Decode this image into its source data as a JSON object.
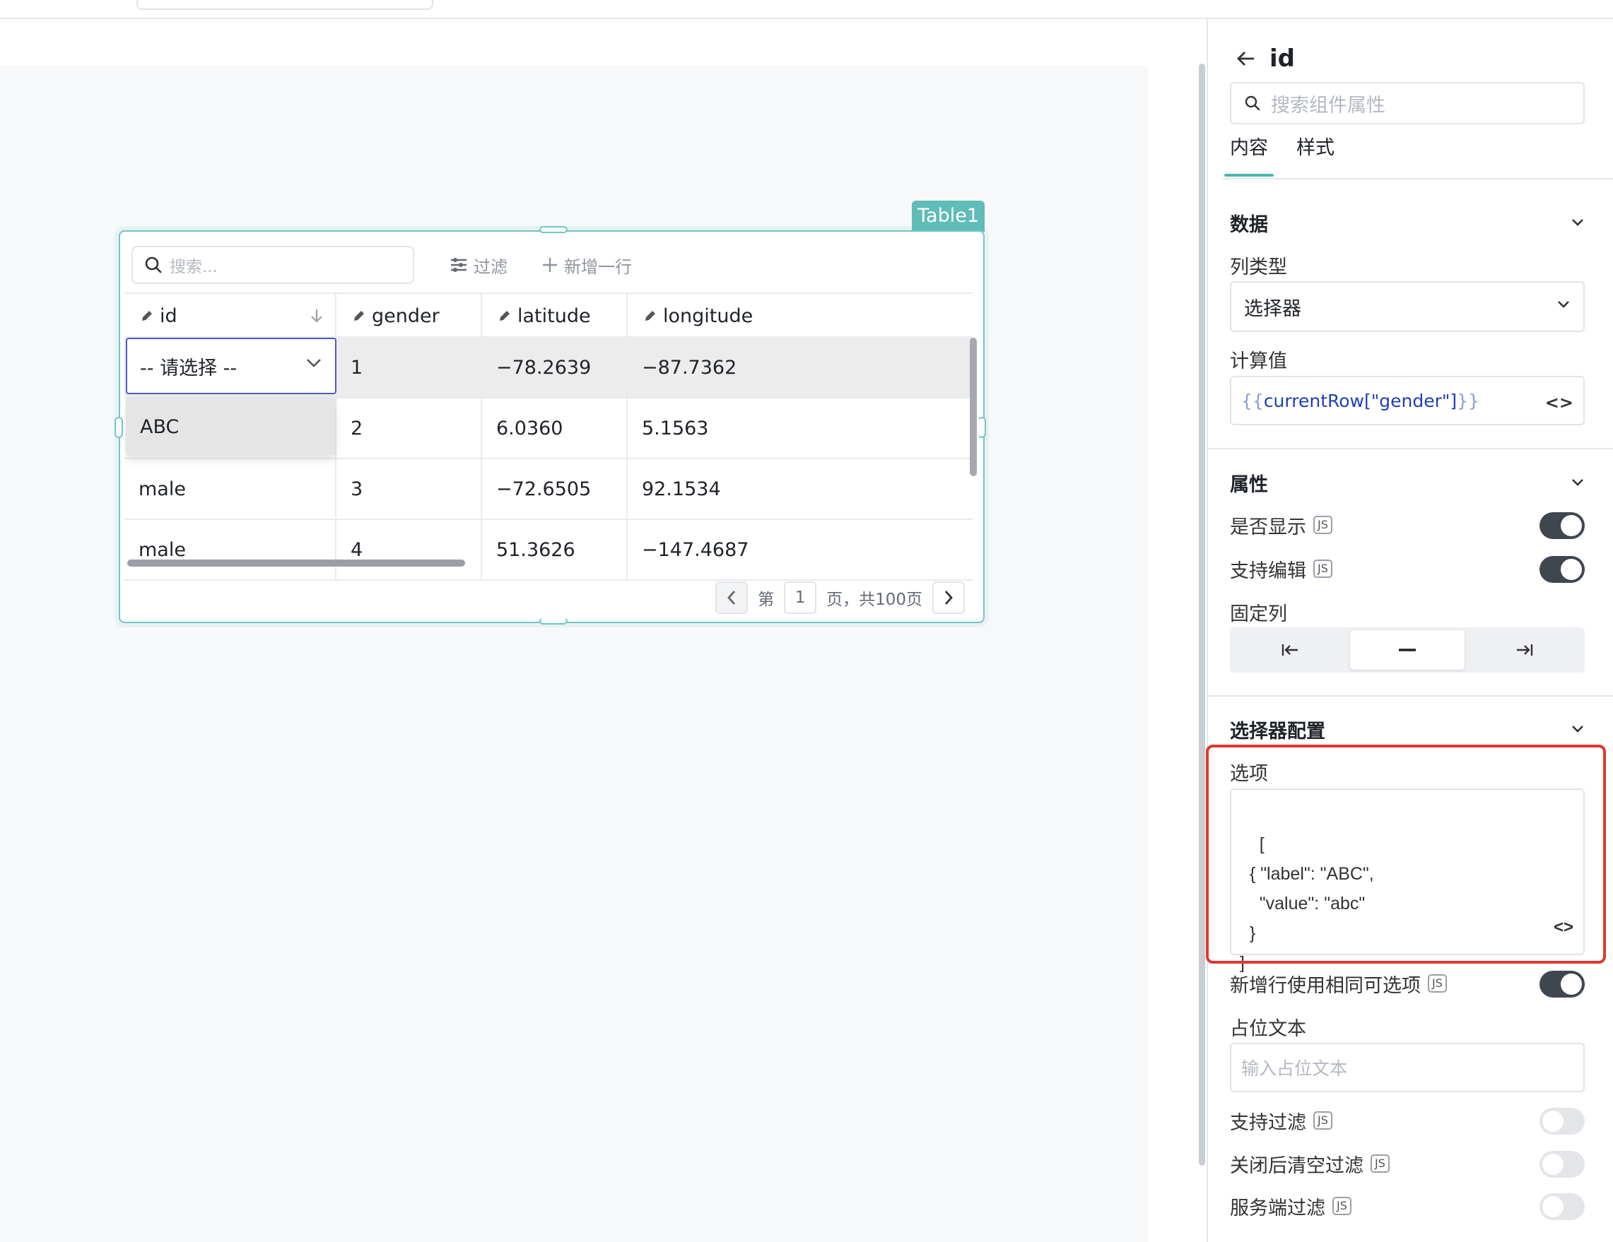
{
  "table": {
    "tag": "Table1",
    "search_placeholder": "搜索...",
    "filter_label": "过滤",
    "add_row_label": "新增一行",
    "columns": [
      "id",
      "gender",
      "latitude",
      "longitude"
    ],
    "rows": [
      {
        "id": "",
        "gender": "1",
        "latitude": "−78.2639",
        "longitude": "−87.7362"
      },
      {
        "id": "",
        "gender": "2",
        "latitude": "6.0360",
        "longitude": "5.1563"
      },
      {
        "id": "male",
        "gender": "3",
        "latitude": "−72.6505",
        "longitude": "92.1534"
      },
      {
        "id": "male",
        "gender": "4",
        "latitude": "51.3626",
        "longitude": "−147.4687"
      }
    ],
    "select_placeholder": "-- 请选择 --",
    "dropdown_option": "ABC",
    "pager": {
      "prefix": "第",
      "page": "1",
      "suffix": "页，共100页"
    }
  },
  "panel": {
    "title": "id",
    "search_placeholder": "搜索组件属性",
    "tabs": [
      "内容",
      "样式"
    ],
    "data_section": {
      "title": "数据",
      "column_type_label": "列类型",
      "column_type_value": "选择器",
      "computed_label": "计算值",
      "computed_open": "{{",
      "computed_value": "currentRow[\"gender\"]",
      "computed_close": "}}"
    },
    "props_section": {
      "title": "属性",
      "visible_label": "是否显示",
      "editable_label": "支持编辑",
      "fixed_label": "固定列",
      "js": "JS"
    },
    "selector_section": {
      "title": "选择器配置",
      "options_label": "选项",
      "options_code": "[\n  { \"label\": \"ABC\",\n    \"value\": \"abc\"\n  }\n]",
      "same_options_label": "新增行使用相同可选项",
      "placeholder_label": "占位文本",
      "placeholder_input": "输入占位文本",
      "filter_label": "支持过滤",
      "clear_filter_label": "关闭后清空过滤",
      "server_filter_label": "服务端过滤"
    },
    "toggles": {
      "visible": true,
      "editable": true,
      "same_options": true,
      "filter": false,
      "clear_filter": false,
      "server_filter": false
    }
  }
}
